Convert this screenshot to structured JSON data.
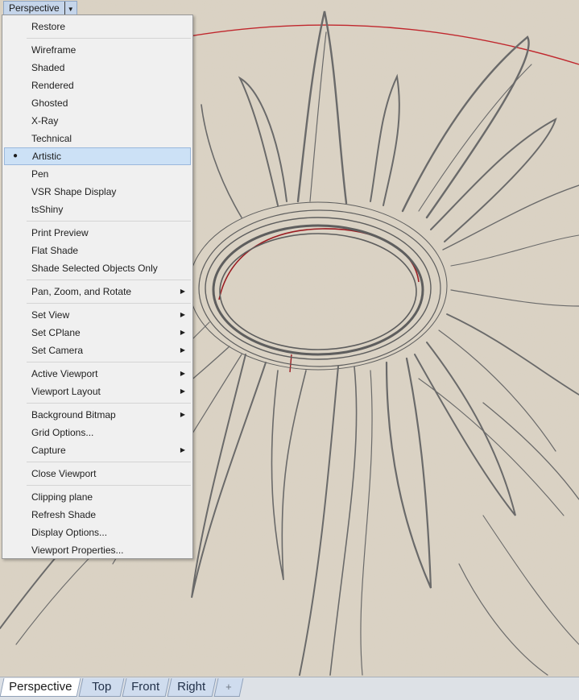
{
  "viewport": {
    "title": "Perspective",
    "dropdown_icon": "chevron-down-icon"
  },
  "menu": {
    "items": [
      {
        "label": "Restore"
      },
      {
        "sep": true
      },
      {
        "label": "Wireframe"
      },
      {
        "label": "Shaded"
      },
      {
        "label": "Rendered"
      },
      {
        "label": "Ghosted"
      },
      {
        "label": "X-Ray"
      },
      {
        "label": "Technical"
      },
      {
        "label": "Artistic",
        "selected": true
      },
      {
        "label": "Pen"
      },
      {
        "label": "VSR Shape Display"
      },
      {
        "label": "tsShiny"
      },
      {
        "sep": true
      },
      {
        "label": "Print Preview"
      },
      {
        "label": "Flat Shade"
      },
      {
        "label": "Shade Selected Objects Only"
      },
      {
        "sep": true
      },
      {
        "label": "Pan, Zoom, and Rotate",
        "submenu": true
      },
      {
        "sep": true
      },
      {
        "label": "Set View",
        "submenu": true
      },
      {
        "label": "Set CPlane",
        "submenu": true
      },
      {
        "label": "Set Camera",
        "submenu": true
      },
      {
        "sep": true
      },
      {
        "label": "Active Viewport",
        "submenu": true
      },
      {
        "label": "Viewport Layout",
        "submenu": true
      },
      {
        "sep": true
      },
      {
        "label": "Background Bitmap",
        "submenu": true
      },
      {
        "label": "Grid Options..."
      },
      {
        "label": "Capture",
        "submenu": true
      },
      {
        "sep": true
      },
      {
        "label": "Close Viewport"
      },
      {
        "sep": true
      },
      {
        "label": "Clipping plane"
      },
      {
        "label": "Refresh Shade"
      },
      {
        "label": "Display Options..."
      },
      {
        "label": "Viewport Properties..."
      }
    ]
  },
  "tabs": [
    {
      "label": "Perspective",
      "active": true
    },
    {
      "label": "Top"
    },
    {
      "label": "Front"
    },
    {
      "label": "Right"
    },
    {
      "label": "+",
      "icon": "add-tab-icon"
    }
  ],
  "colors": {
    "paper": "#d9d1c2",
    "sketch_stroke": "#5e5e5e",
    "curve_red": "#c0272d",
    "menu_bg": "#f0f0f0",
    "menu_selected": "#cce1f6",
    "tab_active": "#ffffff",
    "tab_inactive": "#cfdcee"
  }
}
